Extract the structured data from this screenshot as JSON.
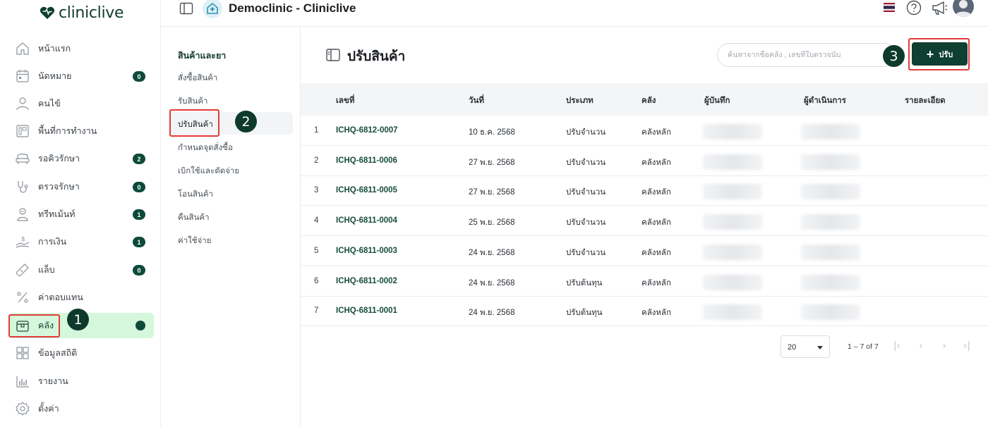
{
  "brand": {
    "name": "cliniclive"
  },
  "header": {
    "title": "Democlinic - Cliniclive"
  },
  "sidebar": {
    "items": [
      {
        "label": "หน้าแรก",
        "icon": "home-icon"
      },
      {
        "label": "นัดหมาย",
        "icon": "calendar-icon",
        "badge": "0"
      },
      {
        "label": "คนไข้",
        "icon": "user-icon"
      },
      {
        "label": "พื้นที่การทำงาน",
        "icon": "workspace-icon"
      },
      {
        "label": "รอคิวรักษา",
        "icon": "seat-icon",
        "badge": "2"
      },
      {
        "label": "ตรวจรักษา",
        "icon": "stethoscope-icon",
        "badge": "0"
      },
      {
        "label": "ทรีทเม้นท์",
        "icon": "treatment-icon",
        "badge": "1"
      },
      {
        "label": "การเงิน",
        "icon": "money-icon",
        "badge": "1"
      },
      {
        "label": "แล็บ",
        "icon": "lab-icon",
        "badge": "0"
      },
      {
        "label": "ค่าตอบแทน",
        "icon": "percent-icon"
      },
      {
        "label": "คลัง",
        "icon": "warehouse-icon",
        "active": true
      },
      {
        "label": "ข้อมูลสถิติ",
        "icon": "stats-icon"
      },
      {
        "label": "รายงาน",
        "icon": "report-icon"
      },
      {
        "label": "ตั้งค่า",
        "icon": "gear-icon"
      }
    ]
  },
  "subnav": {
    "title": "สินค้าและยา",
    "items": [
      {
        "label": "สั่งซื้อสินค้า"
      },
      {
        "label": "รับสินค้า"
      },
      {
        "label": "ปรับสินค้า",
        "active": true
      },
      {
        "label": "กำหนดจุดสั่งซื้อ"
      },
      {
        "label": "เบิกใช้และตัดจ่าย"
      },
      {
        "label": "โอนสินค้า"
      },
      {
        "label": "คืนสินค้า"
      },
      {
        "label": "ค่าใช้จ่าย"
      }
    ]
  },
  "annotations": [
    "1",
    "2",
    "3"
  ],
  "main": {
    "title": "ปรับสินค้า",
    "search_placeholder": "ค้นหาจากชื่อคลัง , เลขที่ใบตรวจนับ",
    "add_button": {
      "icon": "+",
      "label": "ปรับ"
    },
    "table": {
      "columns": [
        "เลขที่",
        "วันที่",
        "ประเภท",
        "คลัง",
        "ผู้บันทึก",
        "ผู้ดำเนินการ",
        "รายละเอียด"
      ],
      "rows": [
        {
          "num": "1",
          "code": "ICHQ-6812-0007",
          "date": "10 ธ.ค. 2568",
          "type": "ปรับจำนวน",
          "warehouse": "คลังหลัก"
        },
        {
          "num": "2",
          "code": "ICHQ-6811-0006",
          "date": "27 พ.ย. 2568",
          "type": "ปรับจำนวน",
          "warehouse": "คลังหลัก"
        },
        {
          "num": "3",
          "code": "ICHQ-6811-0005",
          "date": "27 พ.ย. 2568",
          "type": "ปรับจำนวน",
          "warehouse": "คลังหลัก"
        },
        {
          "num": "4",
          "code": "ICHQ-6811-0004",
          "date": "25 พ.ย. 2568",
          "type": "ปรับจำนวน",
          "warehouse": "คลังหลัก"
        },
        {
          "num": "5",
          "code": "ICHQ-6811-0003",
          "date": "24 พ.ย. 2568",
          "type": "ปรับจำนวน",
          "warehouse": "คลังหลัก"
        },
        {
          "num": "6",
          "code": "ICHQ-6811-0002",
          "date": "24 พ.ย. 2568",
          "type": "ปรับต้นทุน",
          "warehouse": "คลังหลัก"
        },
        {
          "num": "7",
          "code": "ICHQ-6811-0001",
          "date": "24 พ.ย. 2568",
          "type": "ปรับต้นทุน",
          "warehouse": "คลังหลัก"
        }
      ]
    },
    "pagination": {
      "page_size": "20",
      "range": "1 – 7 of 7"
    }
  },
  "colors": {
    "brand": "#0e3f31",
    "active_bg": "#d5f7db",
    "annotation": "#e23a3a"
  }
}
